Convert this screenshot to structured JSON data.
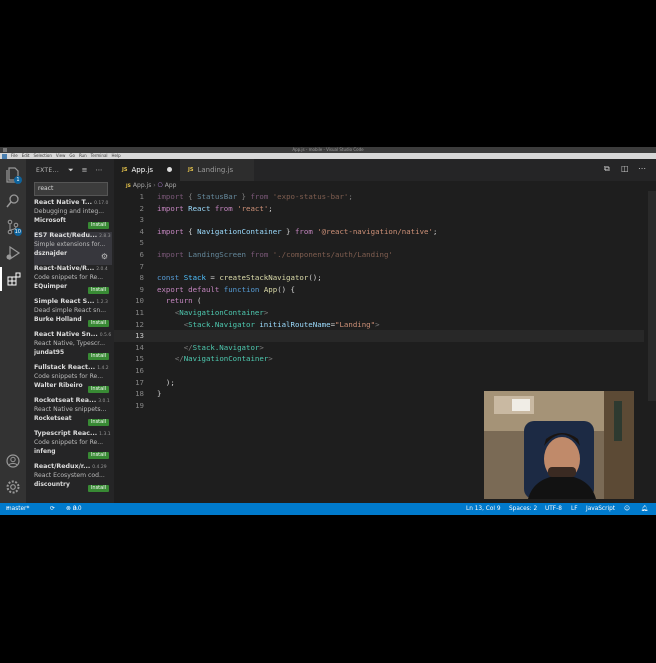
{
  "window": {
    "title": "App.js - mobile - Visual Studio Code"
  },
  "menu": [
    "File",
    "Edit",
    "Selection",
    "View",
    "Go",
    "Run",
    "Terminal",
    "Help"
  ],
  "activity_bar": {
    "items": [
      {
        "icon": "files-icon",
        "badge": "1"
      },
      {
        "icon": "search-icon",
        "badge": ""
      },
      {
        "icon": "source-control-icon",
        "badge": "10"
      },
      {
        "icon": "run-debug-icon",
        "badge": ""
      },
      {
        "icon": "extensions-icon",
        "badge": ""
      }
    ],
    "bottom": [
      {
        "icon": "account-icon"
      },
      {
        "icon": "manage-gear-icon"
      }
    ]
  },
  "sidebar": {
    "title": "EXTE...",
    "search_value": "react",
    "extensions": [
      {
        "name": "React Native T...",
        "version": "0.17.0",
        "description": "Debugging and integ...",
        "publisher": "Microsoft",
        "action": "Install"
      },
      {
        "name": "ES7 React/Redu...",
        "version": "2.8.3",
        "description": "Simple extensions for...",
        "publisher": "dsznajder",
        "action": ""
      },
      {
        "name": "React-Native/R...",
        "version": "2.0.4",
        "description": "Code snippets for Re...",
        "publisher": "EQuimper",
        "action": "Install"
      },
      {
        "name": "Simple React S...",
        "version": "1.2.3",
        "description": "Dead simple React sn...",
        "publisher": "Burke Holland",
        "action": "Install"
      },
      {
        "name": "React Native Sn...",
        "version": "0.5.6",
        "description": "React Native, Typescr...",
        "publisher": "jundat95",
        "action": "Install"
      },
      {
        "name": "Fullstack React...",
        "version": "1.4.2",
        "description": "Code snippets for Re...",
        "publisher": "Walter Ribeiro",
        "action": "Install"
      },
      {
        "name": "Rocketseat Rea...",
        "version": "3.0.1",
        "description": "React Native snippets...",
        "publisher": "Rocketseat",
        "action": "Install"
      },
      {
        "name": "Typescript Reac...",
        "version": "1.3.1",
        "description": "Code snippets for Re...",
        "publisher": "infeng",
        "action": "Install"
      },
      {
        "name": "React/Redux/r...",
        "version": "0.4.29",
        "description": "React Ecosystem cod...",
        "publisher": "discountry",
        "action": "Install"
      }
    ]
  },
  "tabs": [
    {
      "label": "App.js",
      "active": true,
      "modified": true
    },
    {
      "label": "Landing.js",
      "active": false,
      "modified": false
    }
  ],
  "breadcrumb": [
    "App.js",
    "App"
  ],
  "code_lines": [
    {
      "n": "1",
      "text": "import { StatusBar } from 'expo-status-bar';"
    },
    {
      "n": "2",
      "text": "import React from 'react';"
    },
    {
      "n": "3",
      "text": ""
    },
    {
      "n": "4",
      "text": "import { NavigationContainer } from '@react-navigation/native';"
    },
    {
      "n": "5",
      "text": ""
    },
    {
      "n": "6",
      "text": "import LandingScreen from './components/auth/Landing'"
    },
    {
      "n": "7",
      "text": ""
    },
    {
      "n": "8",
      "text": "const Stack = createStackNavigator();"
    },
    {
      "n": "9",
      "text": "export default function App() {"
    },
    {
      "n": "10",
      "text": "  return ("
    },
    {
      "n": "11",
      "text": "    <NavigationContainer>"
    },
    {
      "n": "12",
      "text": "      <Stack.Navigator initialRouteName=\"Landing\">"
    },
    {
      "n": "13",
      "text": ""
    },
    {
      "n": "14",
      "text": "      </Stack.Navigator>"
    },
    {
      "n": "15",
      "text": "    </NavigationContainer>"
    },
    {
      "n": "16",
      "text": ""
    },
    {
      "n": "17",
      "text": "  );"
    },
    {
      "n": "18",
      "text": "}"
    },
    {
      "n": "19",
      "text": ""
    }
  ],
  "status_bar": {
    "branch": "master*",
    "sync_icon": "sync-icon",
    "errors": "0",
    "warnings": "0",
    "position": "Ln 13, Col 9",
    "spaces": "Spaces: 2",
    "encoding": "UTF-8",
    "eol": "LF",
    "language": "JavaScript"
  },
  "colors": {
    "accent": "#007acc",
    "install_button": "#388a34",
    "activity_bar": "#333333",
    "sidebar": "#252526",
    "editor": "#1e1e1e"
  }
}
